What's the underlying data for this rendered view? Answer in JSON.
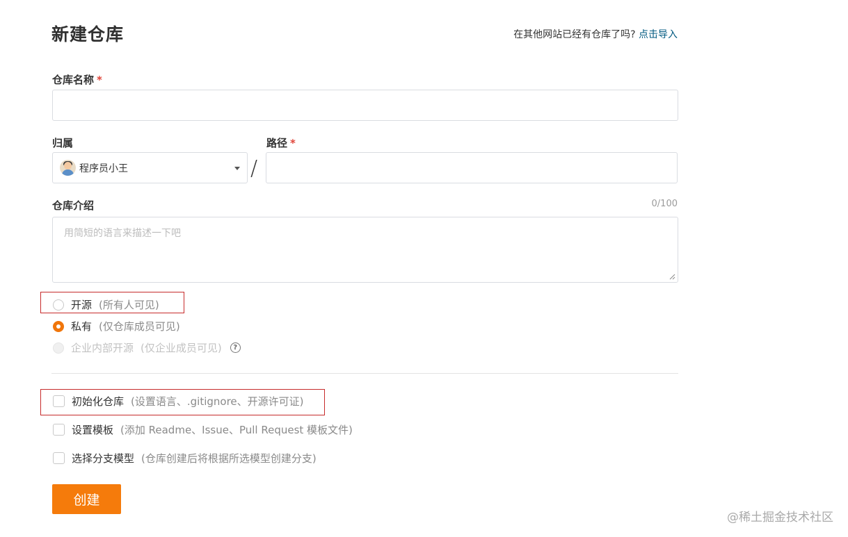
{
  "page": {
    "title": "新建仓库",
    "import_hint": "在其他网站已经有仓库了吗?",
    "import_link": "点击导入"
  },
  "form": {
    "repo_name": {
      "label": "仓库名称",
      "required_mark": "*",
      "value": ""
    },
    "owner": {
      "label": "归属",
      "value": "程序员小王"
    },
    "path_separator": "/",
    "path": {
      "label": "路径",
      "required_mark": "*",
      "value": ""
    },
    "description": {
      "label": "仓库介绍",
      "counter": "0/100",
      "placeholder": "用简短的语言来描述一下吧"
    },
    "visibility": [
      {
        "label": "开源",
        "desc": "(所有人可见)",
        "checked": false,
        "disabled": false
      },
      {
        "label": "私有",
        "desc": "(仅仓库成员可见)",
        "checked": true,
        "disabled": false
      },
      {
        "label": "企业内部开源",
        "desc": "(仅企业成员可见)",
        "checked": false,
        "disabled": true
      }
    ],
    "options": [
      {
        "label": "初始化仓库",
        "desc": "(设置语言、.gitignore、开源许可证)",
        "checked": false
      },
      {
        "label": "设置模板",
        "desc": "(添加 Readme、Issue、Pull Request 模板文件)",
        "checked": false
      },
      {
        "label": "选择分支模型",
        "desc": "(仓库创建后将根据所选模型创建分支)",
        "checked": false
      }
    ],
    "submit_label": "创建"
  },
  "watermark": "@稀土掘金技术社区",
  "colors": {
    "accent": "#f57b0b",
    "link": "#005980",
    "required": "#e0453a",
    "highlight_box": "#c62a2a"
  }
}
